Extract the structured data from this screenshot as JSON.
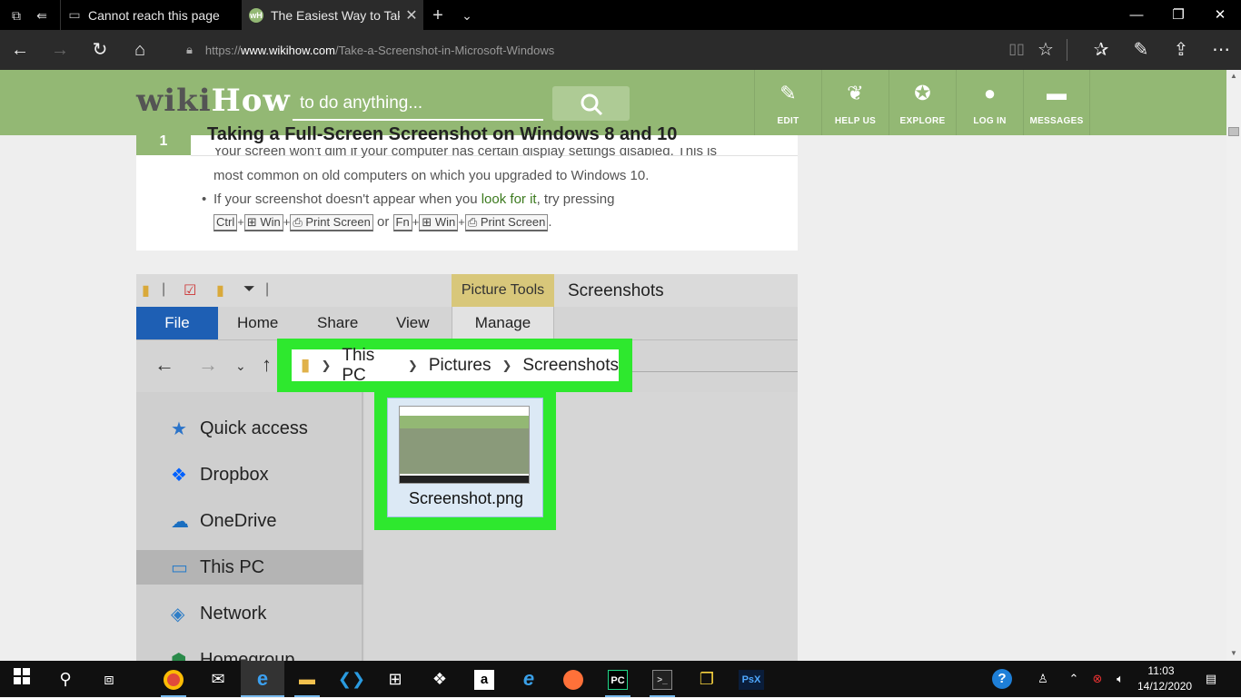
{
  "browser": {
    "tabs": [
      {
        "title": "Cannot reach this page"
      },
      {
        "title": "The Easiest Way to Take",
        "favicon": "wH"
      }
    ],
    "url": {
      "prefix": "https://",
      "host": "www.wikihow.com",
      "path": "/Take-a-Screenshot-in-Microsoft-Windows"
    }
  },
  "wikihow": {
    "logo_wiki": "wiki",
    "logo_how": "How",
    "search_placeholder": "to do anything...",
    "nav": [
      {
        "label": "EDIT",
        "icon": "pencil-icon"
      },
      {
        "label": "HELP US",
        "icon": "sprout-icon"
      },
      {
        "label": "EXPLORE",
        "icon": "compass-icon"
      },
      {
        "label": "LOG IN",
        "icon": "user-icon"
      },
      {
        "label": "MESSAGES",
        "icon": "chat-icon"
      }
    ],
    "accent": "#93b874"
  },
  "article": {
    "step_number": "1",
    "step_title": "Taking a Full-Screen Screenshot on Windows 8 and 10",
    "line1": "Your screen won't dim if your computer has certain display settings disabled. This is",
    "line2": "most common on old computers on which you upgraded to Windows 10.",
    "line3_a": "If your screenshot doesn't appear when you ",
    "line3_link": "look for it",
    "line3_b": ", try pressing",
    "keys": {
      "ctrl": "Ctrl",
      "win": "⊞ Win",
      "print": "⎙ Print Screen",
      "or": "or",
      "fn": "Fn",
      "period": "."
    }
  },
  "explorer": {
    "picture_tools": "Picture Tools",
    "window_title": "Screenshots",
    "tabs": {
      "file": "File",
      "home": "Home",
      "share": "Share",
      "view": "View",
      "manage": "Manage"
    },
    "path": [
      "This PC",
      "Pictures",
      "Screenshots"
    ],
    "sidebar": [
      "Quick access",
      "Dropbox",
      "OneDrive",
      "This PC",
      "Network",
      "Homegroup"
    ],
    "file_name": "Screenshot.png",
    "highlight_color": "#2ee82e"
  },
  "taskbar": {
    "time": "11:03",
    "date": "14/12/2020",
    "apps": [
      "chrome",
      "mail",
      "edge",
      "file-explorer",
      "vscode",
      "store",
      "dropbox",
      "amazon",
      "internet-explorer",
      "firefox",
      "pycharm",
      "terminal",
      "python",
      "photoshop-express"
    ],
    "amazon_glyph": "a",
    "psx_label": "PsX",
    "pc_label": "PC"
  }
}
